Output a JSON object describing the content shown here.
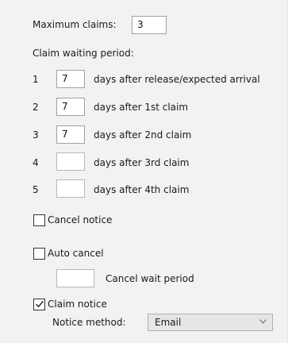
{
  "maximum_claims": {
    "label": "Maximum claims:",
    "value": "3"
  },
  "claim_waiting_period": {
    "heading": "Claim waiting period:",
    "rows": [
      {
        "number": "1",
        "value": "7",
        "label": "days after release/expected arrival"
      },
      {
        "number": "2",
        "value": "7",
        "label": "days after 1st claim"
      },
      {
        "number": "3",
        "value": "7",
        "label": "days after 2nd claim"
      },
      {
        "number": "4",
        "value": "",
        "label": "days after 3rd claim"
      },
      {
        "number": "5",
        "value": "",
        "label": "days after 4th claim"
      }
    ]
  },
  "cancel_notice": {
    "label": "Cancel notice",
    "checked": false
  },
  "auto_cancel": {
    "label": "Auto cancel",
    "checked": false,
    "wait_period_value": "",
    "wait_period_label": "Cancel wait period"
  },
  "claim_notice": {
    "label": "Claim notice",
    "checked": true,
    "method_label": "Notice method:",
    "method_value": "Email",
    "dropdown_icon": "chevron-down-icon"
  }
}
